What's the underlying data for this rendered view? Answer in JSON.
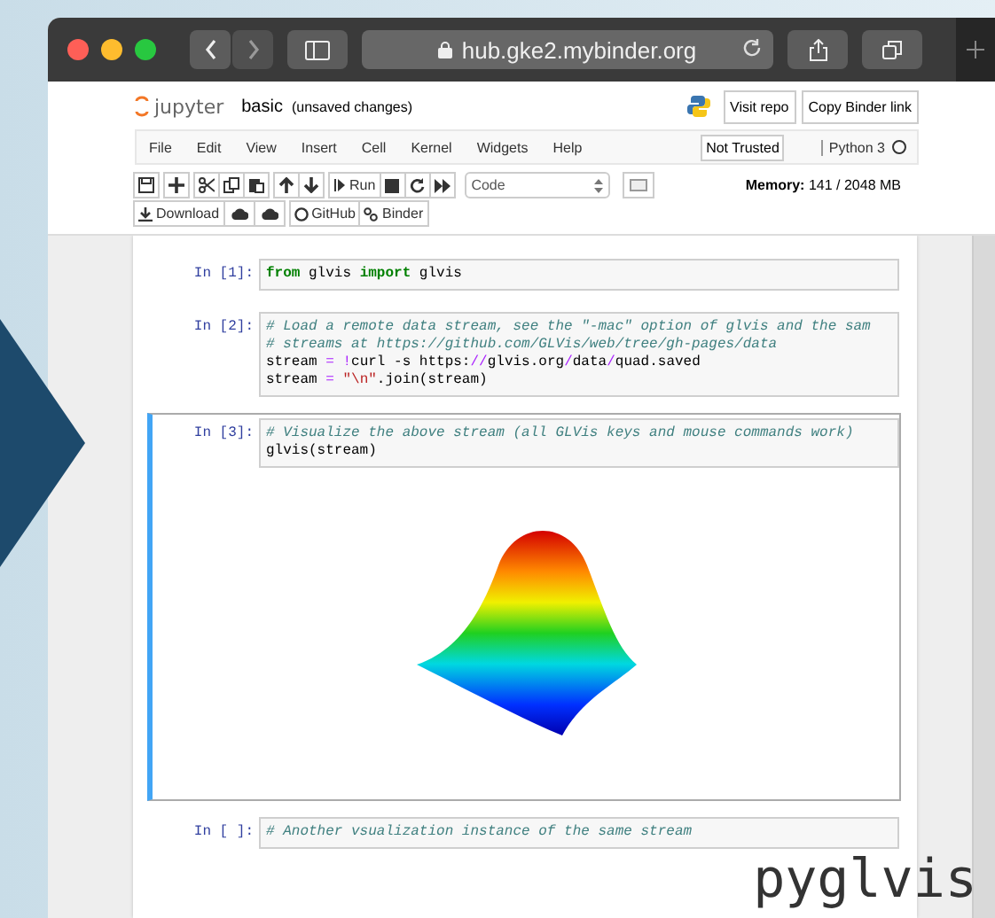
{
  "browser": {
    "address": "hub.gke2.mybinder.org"
  },
  "header": {
    "logo_text": "jupyter",
    "notebook_name": "basic",
    "save_status": "(unsaved changes)",
    "buttons": [
      "Visit repo",
      "Copy Binder link"
    ]
  },
  "menu": {
    "items": [
      "File",
      "Edit",
      "View",
      "Insert",
      "Cell",
      "Kernel",
      "Widgets",
      "Help"
    ],
    "trust": "Not Trusted",
    "kernel": "Python 3",
    "kernel_busy": false
  },
  "toolbar": {
    "run_label": "Run",
    "cell_type": "Code",
    "download": "Download",
    "github": "GitHub",
    "binder": "Binder",
    "memory_label": "Memory:",
    "memory_value": "141 / 2048 MB"
  },
  "cells": [
    {
      "prompt": "In [1]:",
      "selected": false,
      "has_output": false,
      "lines": [
        [
          {
            "kind": "keyword",
            "text": "from"
          },
          {
            "kind": "plain",
            "text": " glvis "
          },
          {
            "kind": "keyword",
            "text": "import"
          },
          {
            "kind": "plain",
            "text": " glvis"
          }
        ]
      ]
    },
    {
      "prompt": "In [2]:",
      "selected": false,
      "has_output": false,
      "lines": [
        [
          {
            "kind": "comment",
            "text": "# Load a remote data stream, see the \"-mac\" option of glvis and the sam"
          }
        ],
        [
          {
            "kind": "comment",
            "text": "# streams at https://github.com/GLVis/web/tree/gh-pages/data"
          }
        ],
        [
          {
            "kind": "plain",
            "text": "stream "
          },
          {
            "kind": "operator",
            "text": "= !"
          },
          {
            "kind": "plain",
            "text": "curl -s https:"
          },
          {
            "kind": "operator",
            "text": "//"
          },
          {
            "kind": "plain",
            "text": "glvis.org"
          },
          {
            "kind": "operator",
            "text": "/"
          },
          {
            "kind": "plain",
            "text": "data"
          },
          {
            "kind": "operator",
            "text": "/"
          },
          {
            "kind": "plain",
            "text": "quad.saved"
          }
        ],
        [
          {
            "kind": "plain",
            "text": "stream "
          },
          {
            "kind": "operator",
            "text": "= "
          },
          {
            "kind": "string",
            "text": "\"\\n\""
          },
          {
            "kind": "plain",
            "text": ".join(stream)"
          }
        ]
      ]
    },
    {
      "prompt": "In [3]:",
      "selected": true,
      "has_output": true,
      "lines": [
        [
          {
            "kind": "comment",
            "text": "# Visualize the above stream (all GLVis keys and mouse commands work)"
          }
        ],
        [
          {
            "kind": "plain",
            "text": "glvis(stream)"
          }
        ]
      ]
    },
    {
      "prompt": "In [ ]:",
      "selected": false,
      "has_output": false,
      "lines": [
        [
          {
            "kind": "comment",
            "text": "# Another vsualization instance of the same stream"
          }
        ]
      ]
    }
  ],
  "overlay": {
    "caption": "pyglvis"
  }
}
